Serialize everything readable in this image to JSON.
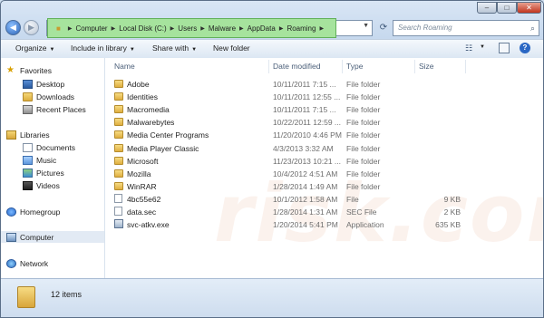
{
  "address": {
    "crumbs": [
      "Computer",
      "Local Disk (C:)",
      "Users",
      "Malware",
      "AppData",
      "Roaming"
    ],
    "highlight_color": "#a6e39d"
  },
  "search": {
    "placeholder": "Search Roaming"
  },
  "toolbar": {
    "organize": "Organize",
    "include": "Include in library",
    "share": "Share with",
    "new_folder": "New folder"
  },
  "nav": {
    "favorites": "Favorites",
    "desktop": "Desktop",
    "downloads": "Downloads",
    "recent": "Recent Places",
    "libraries": "Libraries",
    "documents": "Documents",
    "music": "Music",
    "pictures": "Pictures",
    "videos": "Videos",
    "homegroup": "Homegroup",
    "computer": "Computer",
    "network": "Network"
  },
  "columns": {
    "name": "Name",
    "date": "Date modified",
    "type": "Type",
    "size": "Size"
  },
  "files": [
    {
      "name": "Adobe",
      "date": "10/11/2011 7:15 ...",
      "type": "File folder",
      "size": "",
      "kind": "folder"
    },
    {
      "name": "Identities",
      "date": "10/11/2011 12:55 ...",
      "type": "File folder",
      "size": "",
      "kind": "folder"
    },
    {
      "name": "Macromedia",
      "date": "10/11/2011 7:15 ...",
      "type": "File folder",
      "size": "",
      "kind": "folder"
    },
    {
      "name": "Malwarebytes",
      "date": "10/22/2011 12:59 ...",
      "type": "File folder",
      "size": "",
      "kind": "folder"
    },
    {
      "name": "Media Center Programs",
      "date": "11/20/2010 4:46 PM",
      "type": "File folder",
      "size": "",
      "kind": "folder"
    },
    {
      "name": "Media Player Classic",
      "date": "4/3/2013 3:32 AM",
      "type": "File folder",
      "size": "",
      "kind": "folder"
    },
    {
      "name": "Microsoft",
      "date": "11/23/2013 10:21 ...",
      "type": "File folder",
      "size": "",
      "kind": "folder"
    },
    {
      "name": "Mozilla",
      "date": "10/4/2012 4:51 AM",
      "type": "File folder",
      "size": "",
      "kind": "folder"
    },
    {
      "name": "WinRAR",
      "date": "1/28/2014 1:49 AM",
      "type": "File folder",
      "size": "",
      "kind": "folder"
    },
    {
      "name": "4bc55e62",
      "date": "10/1/2012 1:58 AM",
      "type": "File",
      "size": "9 KB",
      "kind": "file"
    },
    {
      "name": "data.sec",
      "date": "1/28/2014 1:31 AM",
      "type": "SEC File",
      "size": "2 KB",
      "kind": "file"
    },
    {
      "name": "svc-atkv.exe",
      "date": "1/20/2014 5:41 PM",
      "type": "Application",
      "size": "635 KB",
      "kind": "app"
    }
  ],
  "status": {
    "count": "12 items"
  },
  "watermark": "risk.com"
}
